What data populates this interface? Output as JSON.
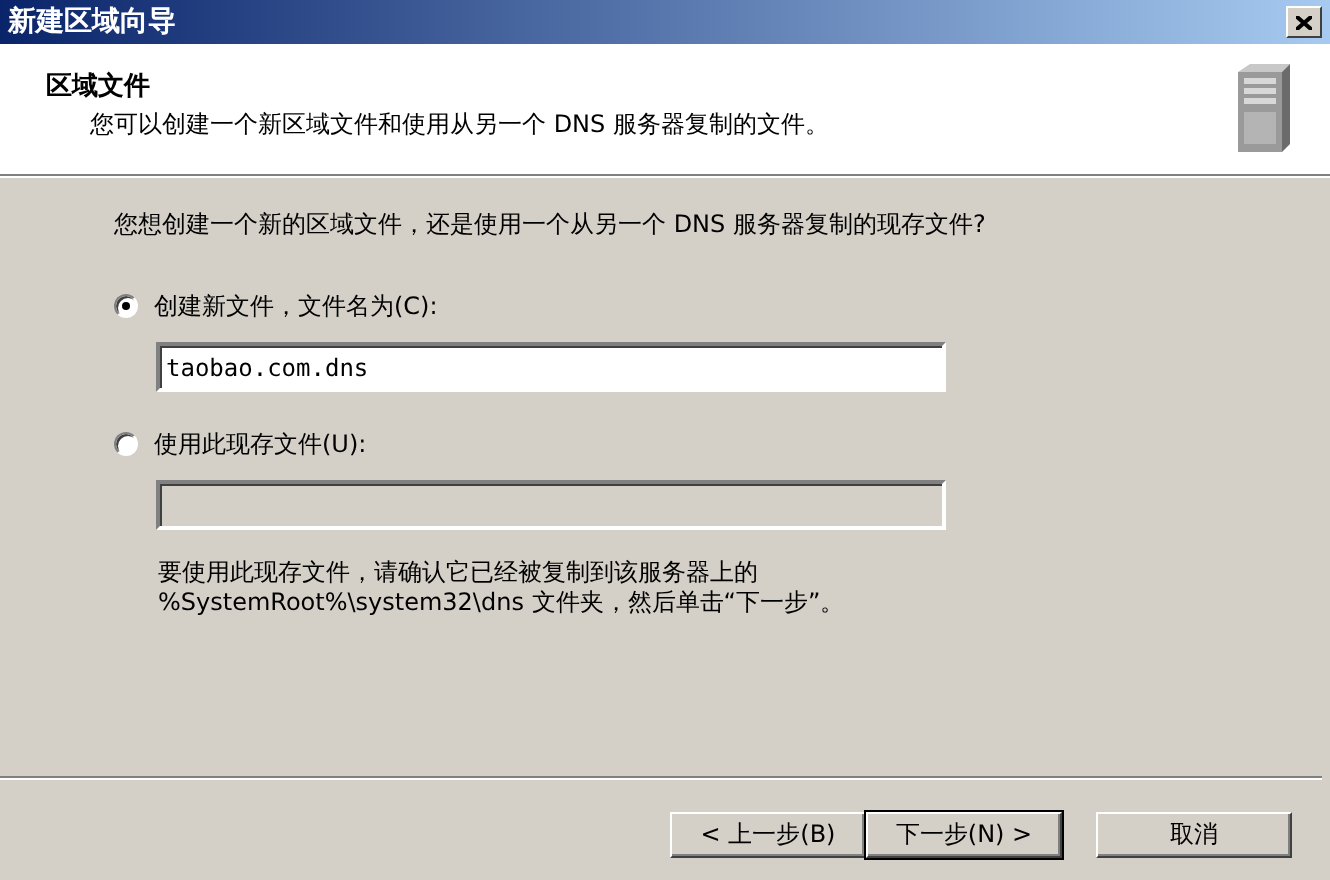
{
  "window": {
    "title": "新建区域向导"
  },
  "header": {
    "title": "区域文件",
    "subtitle": "您可以创建一个新区域文件和使用从另一个 DNS 服务器复制的文件。"
  },
  "question": "您想创建一个新的区域文件，还是使用一个从另一个 DNS 服务器复制的现存文件?",
  "options": [
    {
      "label": "创建新文件，文件名为(C):",
      "selected": true,
      "field": {
        "value": "taobao.com.dns",
        "disabled": false
      }
    },
    {
      "label": "使用此现存文件(U):",
      "selected": false,
      "field": {
        "disabled": true
      }
    }
  ],
  "note": "要使用此现存文件，请确认它已经被复制到该服务器上的\n%SystemRoot%\\system32\\dns 文件夹，然后单击“下一步”。",
  "buttons": [
    {
      "label": "< 上一步(B)",
      "default": false
    },
    {
      "label": "下一步(N) >",
      "default": true
    },
    {
      "label": "取消",
      "default": false
    }
  ]
}
